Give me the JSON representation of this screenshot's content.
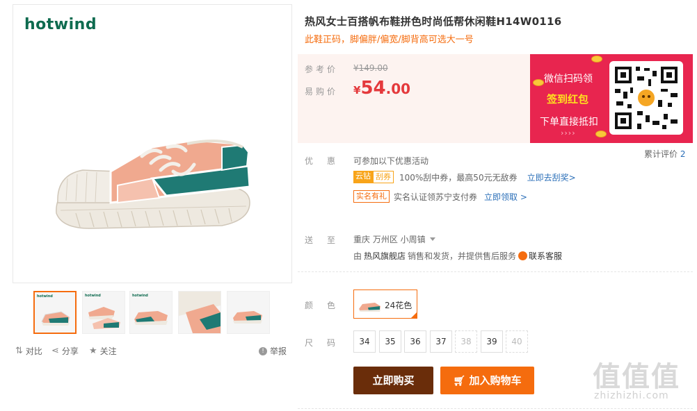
{
  "gallery": {
    "brand": "hotwind",
    "thumb_brand": "hotwind",
    "tools": {
      "compare": "对比",
      "share": "分享",
      "follow": "关注",
      "report": "举报"
    }
  },
  "product": {
    "title": "热风女士百搭帆布鞋拼色时尚低帮休闲鞋H14W0116",
    "subtitle": "此鞋正码，脚偏胖/偏宽/脚背高可选大一号"
  },
  "price": {
    "ref_label": "参考价",
    "ref_value": "¥149.00",
    "buy_label": "易购价",
    "currency": "¥",
    "int": "54",
    "dec": ".00"
  },
  "promo": {
    "line1": "微信扫码领",
    "line2": "签到红包",
    "line3": "下单直接抵扣",
    "arrows": "››››",
    "colors": {
      "bg": "#e8254f",
      "highlight": "#ffe11f"
    }
  },
  "reviews": {
    "label": "累计评价",
    "count": "2"
  },
  "offers": {
    "label": "优惠",
    "intro": "可参加以下优惠活动",
    "coupon": {
      "tag1": "云钻",
      "tag2": "刮券",
      "text": "100%刮中券，最高50元无敌券",
      "link": "立即去刮奖>"
    },
    "realname": {
      "tag": "实名有礼",
      "text": "实名认证领苏宁支付券",
      "link": "立即领取 >"
    }
  },
  "delivery": {
    "label": "送至",
    "location": "重庆 万州区 小周镇",
    "info_prefix": "由",
    "store": "热风旗舰店",
    "info_suffix": "销售和发货，并提供售后服务",
    "service": "联系客服"
  },
  "color": {
    "label": "颜色",
    "selected": "24花色"
  },
  "size": {
    "label": "尺码",
    "options": [
      {
        "v": "34",
        "disabled": false
      },
      {
        "v": "35",
        "disabled": false
      },
      {
        "v": "36",
        "disabled": false
      },
      {
        "v": "37",
        "disabled": false
      },
      {
        "v": "38",
        "disabled": true
      },
      {
        "v": "39",
        "disabled": false
      },
      {
        "v": "40",
        "disabled": true
      }
    ]
  },
  "actions": {
    "buy": "立即购买",
    "cart": "加入购物车"
  },
  "watermark": {
    "main": "值值值",
    "url": "zhizhizhi.com"
  }
}
